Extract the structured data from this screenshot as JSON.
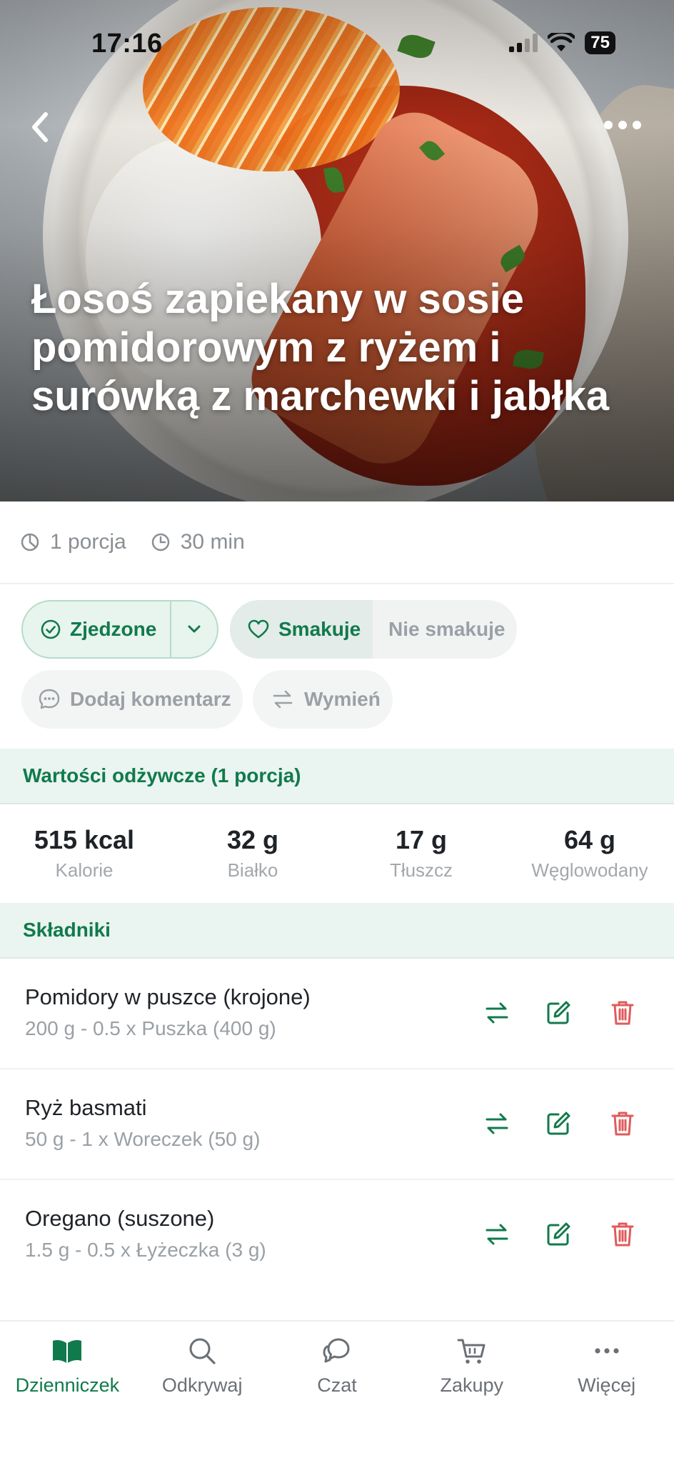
{
  "status_bar": {
    "time": "17:16",
    "battery": "75"
  },
  "recipe": {
    "title": "Łosoś zapiekany w sosie pomidorowym z ryżem i surówką z marchewki i jabłka",
    "portions": "1 porcja",
    "time": "30 min"
  },
  "actions": {
    "eaten_label": "Zjedzone",
    "likes_label": "Smakuje",
    "dislikes_label": "Nie smakuje",
    "comment_label": "Dodaj komentarz",
    "swap_label": "Wymień"
  },
  "nutrition": {
    "header": "Wartości odżywcze (1 porcja)",
    "items": [
      {
        "value": "515 kcal",
        "label": "Kalorie"
      },
      {
        "value": "32 g",
        "label": "Białko"
      },
      {
        "value": "17 g",
        "label": "Tłuszcz"
      },
      {
        "value": "64 g",
        "label": "Węglowodany"
      }
    ]
  },
  "ingredients": {
    "header": "Składniki",
    "items": [
      {
        "name": "Pomidory w puszce (krojone)",
        "amount": "200 g - 0.5 x Puszka (400 g)"
      },
      {
        "name": "Ryż basmati",
        "amount": "50 g - 1 x Woreczek (50 g)"
      },
      {
        "name": "Oregano (suszone)",
        "amount": "1.5 g - 0.5 x Łyżeczka (3 g)"
      }
    ]
  },
  "bottom_nav": {
    "items": [
      {
        "label": "Dzienniczek",
        "icon": "book-icon",
        "active": true
      },
      {
        "label": "Odkrywaj",
        "icon": "search-icon",
        "active": false
      },
      {
        "label": "Czat",
        "icon": "chat-icon",
        "active": false
      },
      {
        "label": "Zakupy",
        "icon": "cart-icon",
        "active": false
      },
      {
        "label": "Więcej",
        "icon": "more-icon",
        "active": false
      }
    ]
  },
  "colors": {
    "accent": "#117a4c",
    "accent_light": "#eaf4f0",
    "delete": "#e05b5b"
  }
}
